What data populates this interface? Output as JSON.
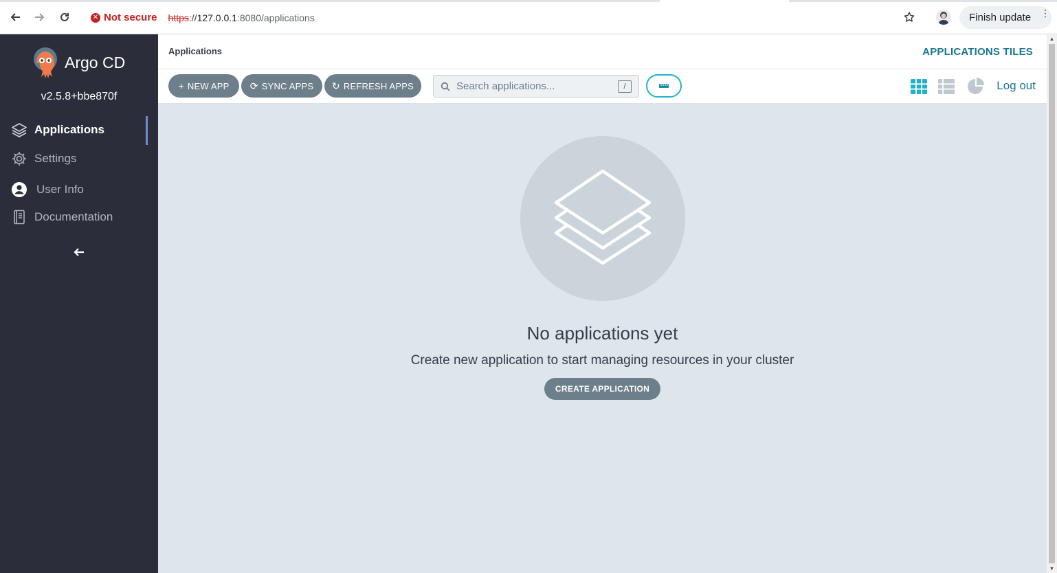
{
  "browser": {
    "security_label": "Not secure",
    "url_scheme": "https",
    "url_sep": "://",
    "url_host": "127.0.0.1",
    "url_path": ":8080/applications",
    "update_label": "Finish update",
    "icons": [
      "back-arrow-icon",
      "forward-arrow-icon",
      "reload-icon",
      "warning-icon",
      "star-icon",
      "profile-avatar",
      "kebab-menu-icon"
    ]
  },
  "sidebar": {
    "brand": "Argo CD",
    "version": "v2.5.8+bbe870f",
    "items": [
      {
        "label": "Applications",
        "icon": "layers-icon",
        "active": true
      },
      {
        "label": "Settings",
        "icon": "gear-icon",
        "active": false
      },
      {
        "label": "User Info",
        "icon": "user-circle-icon",
        "active": false
      },
      {
        "label": "Documentation",
        "icon": "book-icon",
        "active": false
      }
    ],
    "collapse_icon": "arrow-left-icon"
  },
  "topbar": {
    "breadcrumb": "Applications",
    "view_title": "APPLICATIONS TILES"
  },
  "toolbar": {
    "new_app": "NEW APP",
    "sync_apps": "SYNC APPS",
    "refresh_apps": "REFRESH APPS",
    "search_placeholder": "Search applications...",
    "search_shortcut": "/",
    "logout": "Log out",
    "active_view": "tiles",
    "accent": "#1fb3cb"
  },
  "empty": {
    "title": "No applications yet",
    "subtitle": "Create new application to start managing resources in your cluster",
    "button": "CREATE APPLICATION"
  }
}
